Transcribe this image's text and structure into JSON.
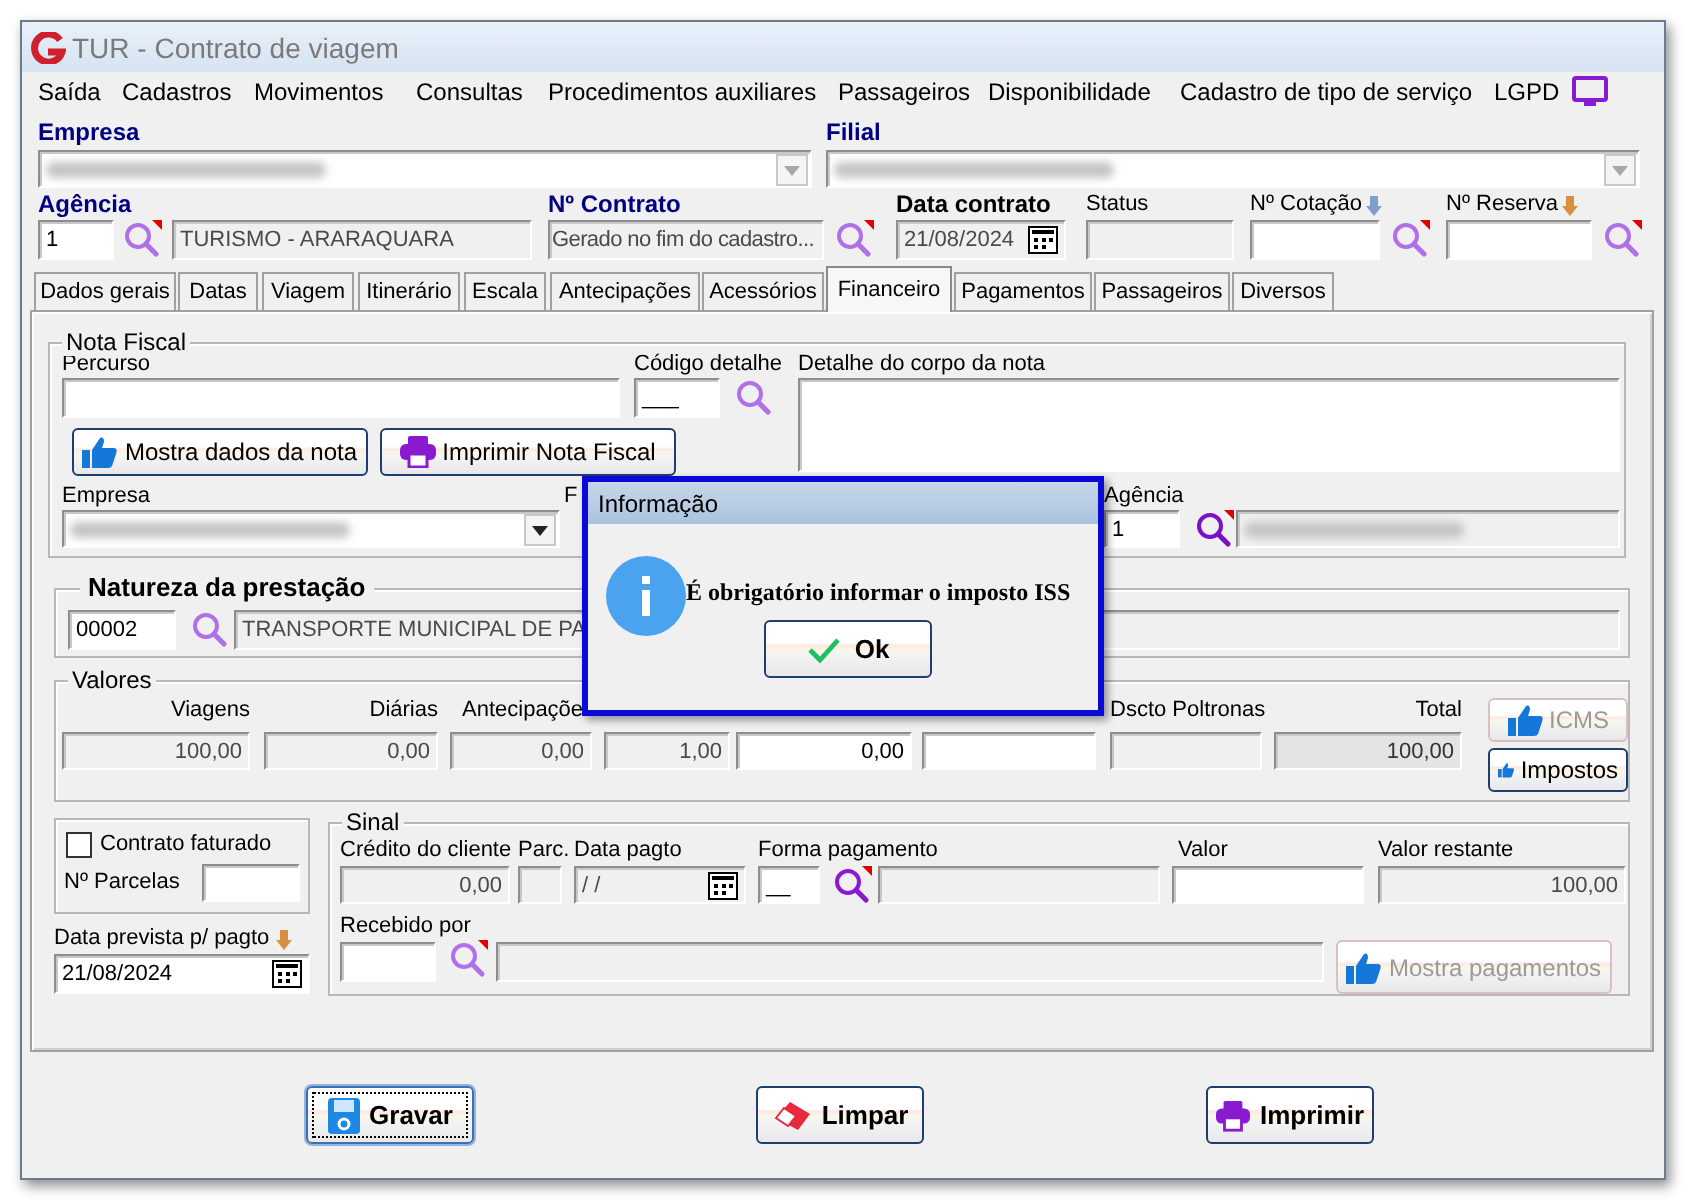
{
  "window": {
    "title": "TUR - Contrato de viagem"
  },
  "menu": [
    "Saída",
    "Cadastros",
    "Movimentos",
    "Consultas",
    "Procedimentos auxiliares",
    "Passageiros",
    "Disponibilidade",
    "Cadastro de tipo de serviço",
    "LGPD"
  ],
  "header": {
    "empresa_label": "Empresa",
    "filial_label": "Filial",
    "agencia": {
      "label": "Agência",
      "code": "1",
      "name": "TURISMO - ARARAQUARA"
    },
    "contrato": {
      "label": "Nº Contrato",
      "value": "Gerado no fim do cadastro..."
    },
    "data_contrato": {
      "label": "Data contrato",
      "value": "21/08/2024"
    },
    "status": {
      "label": "Status"
    },
    "cotacao": {
      "label": "Nº Cotação"
    },
    "reserva": {
      "label": "Nº Reserva"
    }
  },
  "tabs": [
    {
      "label": "Dados gerais",
      "selected": false
    },
    {
      "label": "Datas",
      "selected": false
    },
    {
      "label": "Viagem",
      "selected": false
    },
    {
      "label": "Itinerário",
      "selected": false
    },
    {
      "label": "Escala",
      "selected": false
    },
    {
      "label": "Antecipações",
      "selected": false
    },
    {
      "label": "Acessórios",
      "selected": false
    },
    {
      "label": "Financeiro",
      "selected": true
    },
    {
      "label": "Pagamentos",
      "selected": false
    },
    {
      "label": "Passageiros",
      "selected": false
    },
    {
      "label": "Diversos",
      "selected": false
    }
  ],
  "nota_fiscal": {
    "title": "Nota Fiscal",
    "percurso_label": "Percurso",
    "codigo_label": "Código detalhe",
    "codigo_value": "___",
    "detalhe_label": "Detalhe do corpo da nota",
    "buttons": [
      {
        "label": "Mostra dados da nota",
        "kind": "thumb"
      },
      {
        "label": "Imprimir Nota Fiscal",
        "kind": "print"
      }
    ],
    "empresa_label": "Empresa",
    "covered_label": "F",
    "agencia_label": "Agência",
    "agencia_code": "1"
  },
  "natureza": {
    "title": "Natureza da prestação",
    "code": "00002",
    "description": "TRANSPORTE MUNICIPAL DE PA"
  },
  "valores": {
    "title": "Valores",
    "columns": [
      {
        "label": "Viagens",
        "value": "100,00",
        "kind": "readonly"
      },
      {
        "label": "Diárias",
        "value": "0,00",
        "kind": "readonly"
      },
      {
        "label": "Antecipaçõe",
        "value": "0,00",
        "kind": "readonly"
      },
      {
        "value": "1,00",
        "kind": "readonly"
      },
      {
        "value": "0,00",
        "kind": "editable"
      },
      {
        "kind": "editable"
      },
      {
        "label": "Dscto Poltronas",
        "kind": "readonly"
      },
      {
        "label": "Total",
        "value": "100,00",
        "kind": "total"
      }
    ],
    "buttons": [
      {
        "label": "ICMS",
        "disabled": true
      },
      {
        "label": "Impostos",
        "disabled": false
      }
    ]
  },
  "faturamento": {
    "checkbox": {
      "label": "Contrato faturado",
      "checked": false
    },
    "parcelas_label": "Nº Parcelas",
    "data_prevista": {
      "label": "Data prevista p/ pagto",
      "value": "21/08/2024"
    }
  },
  "sinal": {
    "title": "Sinal",
    "credito": {
      "label": "Crédito do cliente",
      "value": "0,00"
    },
    "parc_label": "Parc.",
    "data_pagto": {
      "label": "Data pagto",
      "value": "/ /"
    },
    "forma": {
      "label": "Forma pagamento",
      "value": "__"
    },
    "valor_label": "Valor",
    "restante": {
      "label": "Valor restante",
      "value": "100,00"
    },
    "recebido_label": "Recebido por",
    "mostra": {
      "label": "Mostra pagamentos",
      "disabled": true
    }
  },
  "actions": [
    {
      "label": "Gravar",
      "kind": "save",
      "focused": true
    },
    {
      "label": "Limpar",
      "kind": "clear",
      "focused": false
    },
    {
      "label": "Imprimir",
      "kind": "print",
      "focused": false
    }
  ],
  "dialog": {
    "title": "Informação",
    "message": "É obrigatório informar o imposto ISS",
    "button": "Ok"
  }
}
